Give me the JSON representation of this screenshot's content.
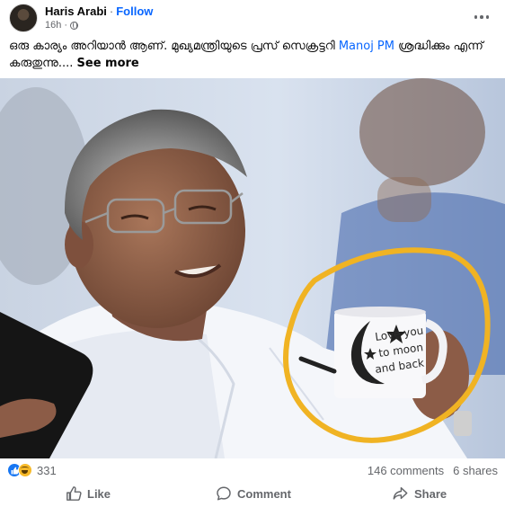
{
  "post": {
    "author": "Haris Arabi",
    "separator": "·",
    "follow_label": "Follow",
    "timestamp": "16h",
    "meta_separator": "·",
    "caption_text": "ഒരു കാര്യം അറിയാൻ ആണ്. മുഖ്യമന്ത്രിയുടെ പ്രസ് സെക്രട്ടറി ",
    "caption_mention": "Manoj PM",
    "caption_text_2": " ശ്രദ്ധിക്കും എന്ന് കരുതുന്നു.... ",
    "see_more_label": "See more"
  },
  "photo": {
    "mug_text_line1": "Love you",
    "mug_text_line2": "to moon",
    "mug_text_line3": "and back",
    "highlight_color": "#f0b323"
  },
  "stats": {
    "reaction_count": "331",
    "comments": "146 comments",
    "shares": "6 shares"
  },
  "actions": {
    "like_label": "Like",
    "comment_label": "Comment",
    "share_label": "Share"
  },
  "icons": {
    "avatar": "profile-photo",
    "privacy": "globe-icon",
    "menu": "more-options-icon",
    "like": "thumbs-up-icon",
    "comment": "speech-bubble-icon",
    "share": "share-arrow-icon"
  },
  "colors": {
    "accent": "#0866ff",
    "secondary_text": "#65676b",
    "like_blue": "#1877f2",
    "haha_yellow": "#f7b928"
  }
}
